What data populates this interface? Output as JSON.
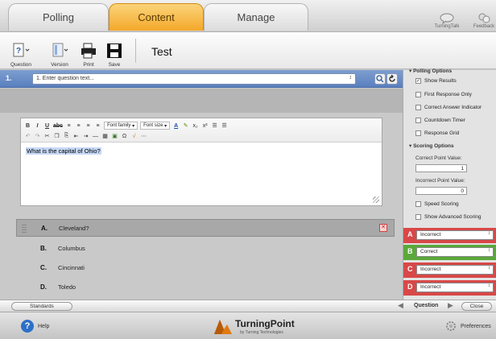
{
  "tabs": [
    {
      "label": "Polling",
      "active": false
    },
    {
      "label": "Content",
      "active": true
    },
    {
      "label": "Manage",
      "active": false
    }
  ],
  "top_right": {
    "turningtalk": "TurningTalk",
    "feedback": "Feedback"
  },
  "toolbar": {
    "question": "Question",
    "version": "Version",
    "print": "Print",
    "save": "Save",
    "doc_title": "Test"
  },
  "question": {
    "number": "1.",
    "select_value": "1. Enter question text..."
  },
  "editor": {
    "font_family": "Font family",
    "font_size": "Font size",
    "text": "What is the capital of Ohio?"
  },
  "answers": [
    {
      "letter": "A.",
      "text": "Cleveland?",
      "selected": true
    },
    {
      "letter": "B.",
      "text": "Columbus",
      "selected": false
    },
    {
      "letter": "C.",
      "text": "Cincinnati",
      "selected": false
    },
    {
      "letter": "D.",
      "text": "Toledo",
      "selected": false
    }
  ],
  "right_panel": {
    "polling_options_header": "Polling Options",
    "show_results": "Show Results",
    "first_response_only": "First Response Only",
    "correct_answer_indicator": "Correct Answer Indicator",
    "countdown_timer": "Countdown Timer",
    "response_grid": "Response Grid",
    "scoring_options_header": "Scoring Options",
    "correct_point_label": "Correct Point Value:",
    "correct_point_value": "1",
    "incorrect_point_label": "Incorrect Point Value:",
    "incorrect_point_value": "0",
    "speed_scoring": "Speed Scoring",
    "show_advanced_scoring": "Show Advanced Scoring"
  },
  "correctness": [
    {
      "letter": "A",
      "value": "Incorrect",
      "color": "#d84848"
    },
    {
      "letter": "B",
      "value": "Correct",
      "color": "#5aa83a"
    },
    {
      "letter": "C",
      "value": "Incorrect",
      "color": "#d84848"
    },
    {
      "letter": "D",
      "value": "Incorrect",
      "color": "#d84848"
    }
  ],
  "bottom": {
    "standards": "Standards",
    "question": "Question",
    "close": "Close"
  },
  "status": {
    "help": "Help",
    "brand": "TurningPoint",
    "brand_sub": "by Turning Technologies",
    "preferences": "Preferences"
  },
  "colors": {
    "accent_orange": "#f4a82a",
    "question_bar": "#5a7fbf"
  }
}
